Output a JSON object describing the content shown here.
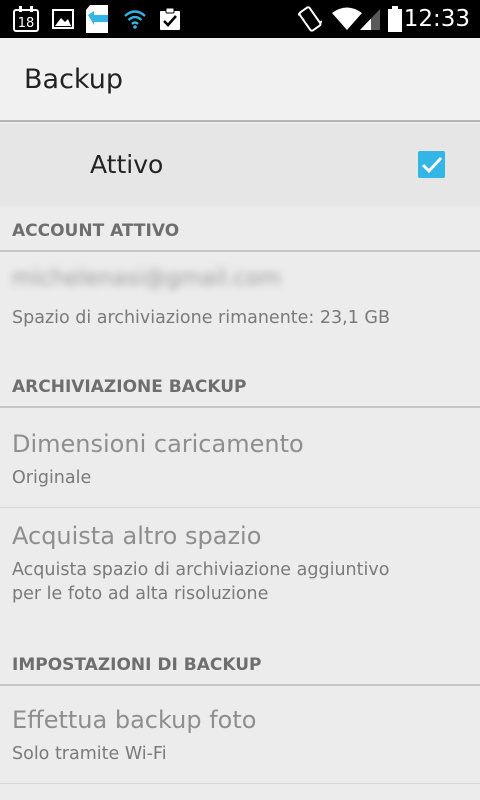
{
  "status_bar": {
    "time": "12:33",
    "calendar_day": "18",
    "icons": [
      "calendar-icon",
      "image-icon",
      "sd-card-icon",
      "wifi-small-icon",
      "clipboard-check-icon",
      "vibrate-icon",
      "wifi-icon",
      "signal-icon",
      "battery-icon"
    ]
  },
  "action_bar": {
    "title": "Backup"
  },
  "master_switch": {
    "label": "Attivo",
    "checked": true,
    "accent_color": "#33b5e5"
  },
  "sections": {
    "account": {
      "header": "ACCOUNT ATTIVO",
      "account_email": "michelenasi@gmail.com",
      "storage_summary": "Spazio di archiviazione rimanente: 23,1 GB"
    },
    "storage": {
      "header": "ARCHIVIAZIONE BACKUP",
      "upload_size": {
        "title": "Dimensioni caricamento",
        "summary": "Originale"
      },
      "buy_storage": {
        "title": "Acquista altro spazio",
        "summary": "Acquista spazio di archiviazione aggiuntivo per le foto ad alta risoluzione"
      }
    },
    "settings": {
      "header": "IMPOSTAZIONI DI BACKUP",
      "backup_photos": {
        "title": "Effettua backup foto",
        "summary": "Solo tramite Wi-Fi"
      }
    }
  }
}
